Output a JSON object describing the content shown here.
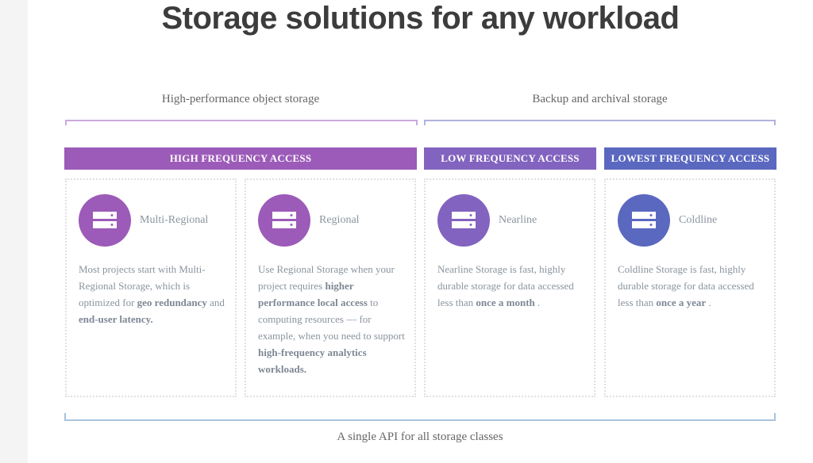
{
  "title": "Storage solutions for any workload",
  "groups": [
    {
      "label": "High-performance object storage",
      "color": "#c9a8dd"
    },
    {
      "label": "Backup and archival storage",
      "color": "#b2b2e0"
    }
  ],
  "bands": [
    {
      "label": "HIGH FREQUENCY ACCESS",
      "color": "#9c5bb8"
    },
    {
      "label": "LOW FREQUENCY ACCESS",
      "color": "#8263bf"
    },
    {
      "label": "LOWEST FREQUENCY ACCESS",
      "color": "#5b68c0"
    }
  ],
  "classes": [
    {
      "name": "Multi-Regional",
      "icon": "storage-server-icon",
      "color": "#9c5bb8",
      "description": [
        {
          "text": "Most projects start with Multi-Regional Storage, which is optimized for ",
          "bold": false
        },
        {
          "text": "geo redundancy",
          "bold": true
        },
        {
          "text": " and ",
          "bold": false
        },
        {
          "text": "end-user latency.",
          "bold": true
        }
      ]
    },
    {
      "name": "Regional",
      "icon": "storage-server-icon",
      "color": "#9c5bb8",
      "description": [
        {
          "text": "Use Regional Storage when your project requires ",
          "bold": false
        },
        {
          "text": "higher performance local access",
          "bold": true
        },
        {
          "text": " to computing resources — for example, when you need to support ",
          "bold": false
        },
        {
          "text": "high-frequency analytics workloads.",
          "bold": true
        }
      ]
    },
    {
      "name": "Nearline",
      "icon": "storage-server-icon",
      "color": "#8263bf",
      "description": [
        {
          "text": "Nearline Storage is fast, highly durable storage for data accessed less than ",
          "bold": false
        },
        {
          "text": "once a month",
          "bold": true
        },
        {
          "text": " .",
          "bold": false
        }
      ]
    },
    {
      "name": "Coldline",
      "icon": "storage-server-icon",
      "color": "#5b68c0",
      "description": [
        {
          "text": "Coldline Storage is fast, highly durable storage for data accessed less than ",
          "bold": false
        },
        {
          "text": "once a year",
          "bold": true
        },
        {
          "text": " .",
          "bold": false
        }
      ]
    }
  ],
  "footer": "A single API for all storage classes"
}
